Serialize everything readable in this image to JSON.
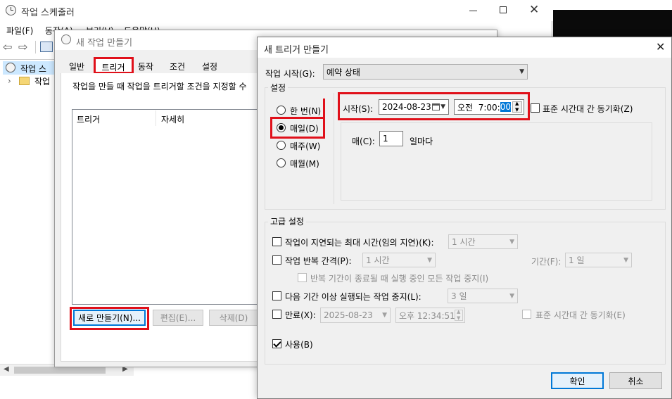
{
  "scheduler": {
    "title": "작업 스케줄러",
    "menu": [
      "파일(F)",
      "동작(A)",
      "보기(V)",
      "도움말(H)"
    ],
    "tree": [
      "작업 스",
      "작업"
    ]
  },
  "create_task": {
    "title": "새 작업 만들기",
    "tabs": [
      "일반",
      "트리거",
      "동작",
      "조건",
      "설정"
    ],
    "description": "작업을 만들 때 작업을 트리거할 조건을 지정할 수",
    "columns": [
      "트리거",
      "자세히"
    ],
    "new_button": "새로 만들기(N)...",
    "edit_button": "편집(E)...",
    "delete_button": "삭제(D)"
  },
  "trigger_dialog": {
    "title": "새 트리거 만들기",
    "begin_label": "작업 시작(G):",
    "begin_value": "예약 상태",
    "settings_title": "설정",
    "radios": [
      "한 번(N)",
      "매일(D)",
      "매주(W)",
      "매월(M)"
    ],
    "selected_radio": 1,
    "start_label": "시작(S):",
    "start_date": "2024-08-23",
    "start_time_prefix": "오전  7:00:",
    "start_time_selected": "00",
    "sync_tz_label": "표준 시간대 간 동기화(Z)",
    "every_label": "매(C):",
    "every_value": "1",
    "every_unit": "일마다",
    "advanced_title": "고급 설정",
    "delay_label": "작업이 지연되는 최대 시간(임의 지연)(K):",
    "delay_value": "1 시간",
    "repeat_label": "작업 반복 간격(P):",
    "repeat_value": "1 시간",
    "duration_label": "기간(F):",
    "duration_value": "1 일",
    "stop_repeat_label": "반복 기간이 종료될 때 실행 중인 모든 작업 중지(I)",
    "stop_long_label": "다음 기간 이상 실행되는 작업 중지(L):",
    "stop_long_value": "3 일",
    "expire_label": "만료(X):",
    "expire_date": "2025-08-23",
    "expire_time": "오후 12:34:51",
    "expire_sync_label": "표준 시간대 간 동기화(E)",
    "enabled_label": "사용(B)",
    "ok_button": "확인",
    "cancel_button": "취소"
  }
}
